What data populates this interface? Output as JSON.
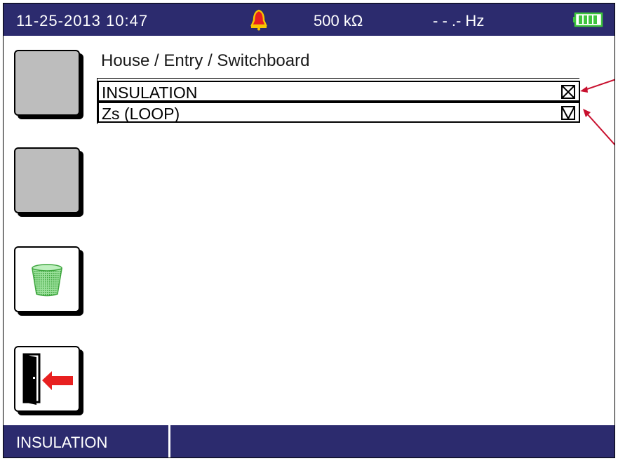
{
  "status_bar": {
    "datetime": "11-25-2013  10:47",
    "alarm_icon": "alarm-bell-icon",
    "voltage": "500  kΩ",
    "frequency": "- - .-  Hz",
    "battery_icon": "battery-full-icon"
  },
  "side_buttons": [
    {
      "name": "blank-button-1",
      "style": "grey"
    },
    {
      "name": "blank-button-2",
      "style": "grey"
    },
    {
      "name": "delete-button",
      "icon": "trash-bin-icon"
    },
    {
      "name": "exit-button",
      "icon": "exit-door-icon"
    }
  ],
  "breadcrumb": "House / Entry / Switchboard",
  "tests": [
    {
      "label": "INSULATION",
      "checkbox": "x-mark"
    },
    {
      "label": "Zs (LOOP)",
      "checkbox": "check-mark"
    }
  ],
  "bottom_bar": {
    "selected_tab": "INSULATION"
  },
  "colors": {
    "bar_background": "#2c2b6e",
    "button_grey": "#bdbdbd",
    "trash_green": "#7bd17b",
    "exit_red": "#e82020",
    "annotation_arrow": "#c8102e"
  }
}
